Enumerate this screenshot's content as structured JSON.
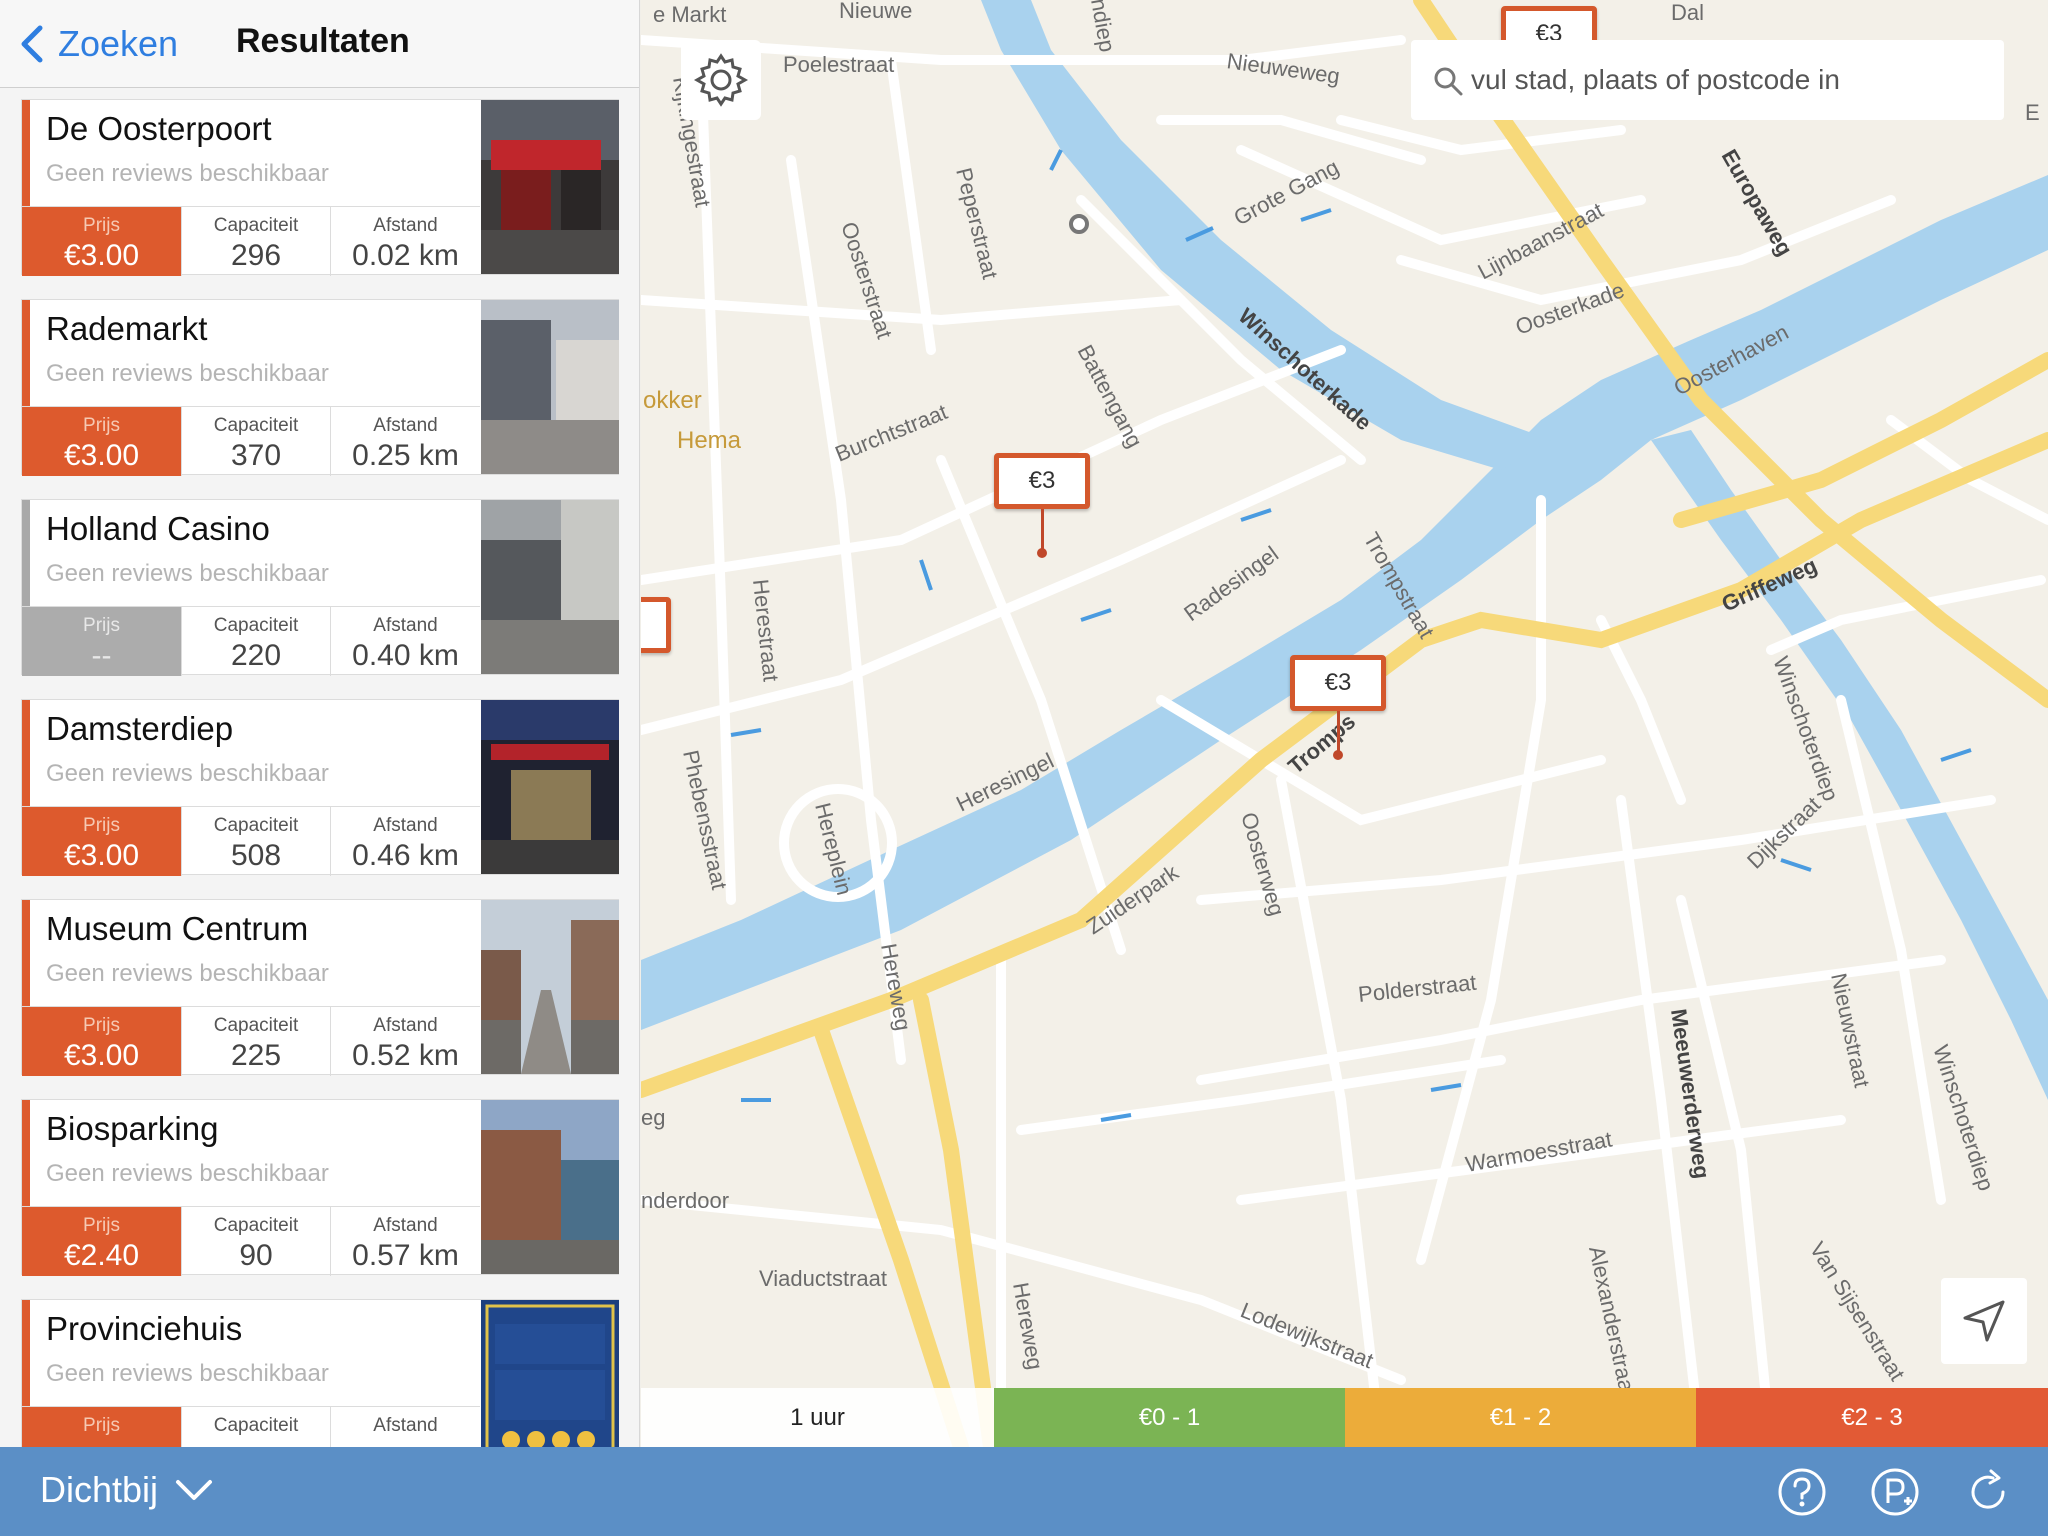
{
  "nav": {
    "back_label": "Zoeken",
    "title": "Resultaten"
  },
  "labels": {
    "price": "Prijs",
    "capacity": "Capaciteit",
    "distance": "Afstand"
  },
  "results": [
    {
      "name": "De Oosterpoort",
      "reviews": "Geen reviews beschikbaar",
      "price": "€3.00",
      "capacity": "296",
      "distance": "0.02 km",
      "price_available": true
    },
    {
      "name": "Rademarkt",
      "reviews": "Geen reviews beschikbaar",
      "price": "€3.00",
      "capacity": "370",
      "distance": "0.25 km",
      "price_available": true
    },
    {
      "name": "Holland Casino",
      "reviews": "Geen reviews beschikbaar",
      "price": "--",
      "capacity": "220",
      "distance": "0.40 km",
      "price_available": false
    },
    {
      "name": "Damsterdiep",
      "reviews": "Geen reviews beschikbaar",
      "price": "€3.00",
      "capacity": "508",
      "distance": "0.46 km",
      "price_available": true
    },
    {
      "name": "Museum Centrum",
      "reviews": "Geen reviews beschikbaar",
      "price": "€3.00",
      "capacity": "225",
      "distance": "0.52 km",
      "price_available": true
    },
    {
      "name": "Biosparking",
      "reviews": "Geen reviews beschikbaar",
      "price": "€2.40",
      "capacity": "90",
      "distance": "0.57 km",
      "price_available": true
    },
    {
      "name": "Provinciehuis",
      "reviews": "Geen reviews beschikbaar",
      "price": "",
      "capacity": "",
      "distance": "",
      "price_available": true
    }
  ],
  "map": {
    "search_placeholder": "vul stad, plaats of postcode in",
    "pin_label": "€3",
    "street_labels": {
      "markt": "e Markt",
      "nieuwe": "Nieuwe",
      "poelestraat": "Poelestraat",
      "nieuweweg": "Nieuweweg",
      "kingestraat": "Kijkingestraat",
      "peperstraat": "Peperstraat",
      "oosterstraat": "Oosterstraat",
      "grote_gang": "Grote Gang",
      "ljinbaanstraat": "Lijnbaanstraat",
      "oosterkade": "Oosterkade",
      "europaweg": "Europaweg",
      "winschoterkade": "Winschoterkade",
      "battengang": "Battengang",
      "burchtstraat": "Burchtstraat",
      "oosterhaven": "Oosterhaven",
      "herestraat": "Herestraat",
      "radesingel": "Radesingel",
      "trompstraat": "Trompstraat",
      "griffeweg": "Griffeweg",
      "heresingel": "Heresingel",
      "phebensstraat": "Phebensstraat",
      "hereplein": "Hereplein",
      "herewerg_a": "Hereweg",
      "zuiderpark": "Zuiderpark",
      "oosterweg": "Oosterweg",
      "tromp": "Tromps",
      "winschoterdiep": "Winschoterdiep",
      "dijkstraat": "Dijkstraat",
      "polderstraat": "Polderstraat",
      "meeuwerderweg": "Meeuwerderweg",
      "nieuwstraat": "Nieuwstraat",
      "warmoesstraat": "Warmoesstraat",
      "viaductstraat": "Viaductstraat",
      "herewerg_b": "Hereweg",
      "lodewijkstraat": "Lodewijkstraat",
      "alexanderstraat": "Alexanderstraat",
      "van_sijsenstraat": "Van Sijsenstraat",
      "eg": "eg",
      "nderdoor": "nderdoor",
      "diep": "ndiep",
      "dal": "Dal",
      "e": "E"
    },
    "poi": {
      "okker": "okker",
      "hema": "Hema"
    }
  },
  "legend": {
    "time": "1 uur",
    "green": "€0 - 1",
    "yellow": "€1 - 2",
    "red": "€2 - 3"
  },
  "bottom": {
    "nearby_label": "Dichtbij"
  },
  "colors": {
    "accent": "#dd5a2d",
    "bar": "#5b8fc6",
    "water": "#a9d2ee",
    "link": "#2f7ee0"
  },
  "icons": [
    "chevron-left-icon",
    "gear-icon",
    "search-icon",
    "location-arrow-icon",
    "chevron-down-icon",
    "help-icon",
    "add-parking-icon",
    "refresh-icon"
  ]
}
